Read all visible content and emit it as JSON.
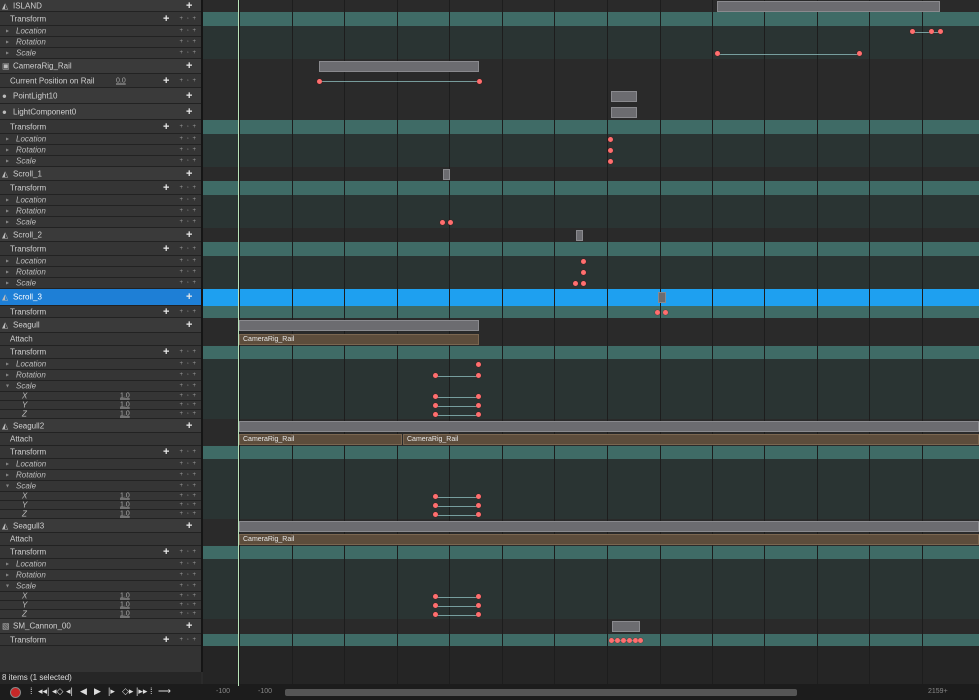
{
  "tree": [
    {
      "kind": "obj",
      "label": "ISLAND",
      "icon": "actor-icon",
      "plus": true
    },
    {
      "kind": "sub",
      "label": "Transform",
      "plus": true,
      "keydots": "+ ◦ +"
    },
    {
      "kind": "prop",
      "label": "Location",
      "keydots": "+ ◦ +"
    },
    {
      "kind": "prop",
      "label": "Rotation",
      "keydots": "+ ◦ +"
    },
    {
      "kind": "prop",
      "label": "Scale",
      "keydots": "+ ◦ +"
    },
    {
      "kind": "obj",
      "label": "CameraRig_Rail",
      "icon": "camera-rig-icon",
      "plus": true
    },
    {
      "kind": "sub",
      "label": "Current Position on Rail",
      "value": "0.0",
      "plus": true,
      "keydots": "+ ◦ +"
    },
    {
      "kind": "obj",
      "label": "PointLight10",
      "icon": "light-icon",
      "plus": true
    },
    {
      "kind": "obj",
      "label": "LightComponent0",
      "icon": "light-icon",
      "plus": true
    },
    {
      "kind": "sub",
      "label": "Transform",
      "plus": true,
      "keydots": "+ ◦ +"
    },
    {
      "kind": "prop",
      "label": "Location",
      "keydots": "+ ◦ +"
    },
    {
      "kind": "prop",
      "label": "Rotation",
      "keydots": "+ ◦ +"
    },
    {
      "kind": "prop",
      "label": "Scale",
      "keydots": "+ ◦ +"
    },
    {
      "kind": "obj",
      "label": "Scroll_1",
      "icon": "actor-icon",
      "plus": true
    },
    {
      "kind": "sub",
      "label": "Transform",
      "plus": true,
      "keydots": "+ ◦ +"
    },
    {
      "kind": "prop",
      "label": "Location",
      "keydots": "+ ◦ +"
    },
    {
      "kind": "prop",
      "label": "Rotation",
      "keydots": "+ ◦ +"
    },
    {
      "kind": "prop",
      "label": "Scale",
      "keydots": "+ ◦ +"
    },
    {
      "kind": "obj",
      "label": "Scroll_2",
      "icon": "actor-icon",
      "plus": true
    },
    {
      "kind": "sub",
      "label": "Transform",
      "plus": true,
      "keydots": "+ ◦ +"
    },
    {
      "kind": "prop",
      "label": "Location",
      "keydots": "+ ◦ +"
    },
    {
      "kind": "prop",
      "label": "Rotation",
      "keydots": "+ ◦ +"
    },
    {
      "kind": "prop",
      "label": "Scale",
      "keydots": "+ ◦ +"
    },
    {
      "kind": "sel",
      "label": "Scroll_3",
      "icon": "actor-icon",
      "plus": true
    },
    {
      "kind": "sub",
      "label": "Transform",
      "plus": true,
      "keydots": "+ ◦ +"
    },
    {
      "kind": "obj",
      "label": "Seagull",
      "icon": "actor-icon",
      "plus": true
    },
    {
      "kind": "sub",
      "label": "Attach"
    },
    {
      "kind": "sub",
      "label": "Transform",
      "plus": true,
      "keydots": "+ ◦ +"
    },
    {
      "kind": "prop",
      "label": "Location",
      "keydots": "+ ◦ +"
    },
    {
      "kind": "prop",
      "label": "Rotation",
      "keydots": "+ ◦ +"
    },
    {
      "kind": "prop",
      "label": "Scale",
      "open": true,
      "keydots": "+ ◦ +"
    },
    {
      "kind": "axis",
      "label": "X",
      "value": "1.0",
      "keydots": "+ ◦ +"
    },
    {
      "kind": "axis",
      "label": "Y",
      "value": "1.0",
      "keydots": "+ ◦ +"
    },
    {
      "kind": "axis",
      "label": "Z",
      "value": "1.0",
      "keydots": "+ ◦ +"
    },
    {
      "kind": "obj",
      "label": "Seagull2",
      "icon": "actor-icon",
      "plus": true
    },
    {
      "kind": "sub",
      "label": "Attach"
    },
    {
      "kind": "sub",
      "label": "Transform",
      "plus": true,
      "keydots": "+ ◦ +"
    },
    {
      "kind": "prop",
      "label": "Location",
      "keydots": "+ ◦ +"
    },
    {
      "kind": "prop",
      "label": "Rotation",
      "keydots": "+ ◦ +"
    },
    {
      "kind": "prop",
      "label": "Scale",
      "open": true,
      "keydots": "+ ◦ +"
    },
    {
      "kind": "axis",
      "label": "X",
      "value": "1.0",
      "keydots": "+ ◦ +"
    },
    {
      "kind": "axis",
      "label": "Y",
      "value": "1.0",
      "keydots": "+ ◦ +"
    },
    {
      "kind": "axis",
      "label": "Z",
      "value": "1.0",
      "keydots": "+ ◦ +"
    },
    {
      "kind": "obj",
      "label": "Seagull3",
      "icon": "actor-icon",
      "plus": true
    },
    {
      "kind": "sub",
      "label": "Attach"
    },
    {
      "kind": "sub",
      "label": "Transform",
      "plus": true,
      "keydots": "+ ◦ +"
    },
    {
      "kind": "prop",
      "label": "Location",
      "keydots": "+ ◦ +"
    },
    {
      "kind": "prop",
      "label": "Rotation",
      "keydots": "+ ◦ +"
    },
    {
      "kind": "prop",
      "label": "Scale",
      "open": true,
      "keydots": "+ ◦ +"
    },
    {
      "kind": "axis",
      "label": "X",
      "value": "1.0",
      "keydots": "+ ◦ +"
    },
    {
      "kind": "axis",
      "label": "Y",
      "value": "1.0",
      "keydots": "+ ◦ +"
    },
    {
      "kind": "axis",
      "label": "Z",
      "value": "1.0",
      "keydots": "+ ◦ +"
    },
    {
      "kind": "obj",
      "label": "SM_Cannon_00",
      "icon": "mesh-icon",
      "plus": true
    },
    {
      "kind": "sub",
      "label": "Transform",
      "plus": true,
      "keydots": "+ ◦ +"
    }
  ],
  "attach_labels": {
    "seagull": [
      "CameraRig_Rail"
    ],
    "seagull2": [
      "CameraRig_Rail",
      "CameraRig_Rail"
    ],
    "seagull3": [
      "CameraRig_Rail"
    ]
  },
  "status": {
    "items_text": "8 items (1 selected)"
  },
  "transport": {
    "range_start_a": "-100",
    "range_start_b": "-100",
    "range_end": "2159+",
    "buttons": [
      "step-icon",
      "jump-start-icon",
      "prev-key-icon",
      "step-back-icon",
      "play-reverse-icon",
      "play-icon",
      "step-forward-icon",
      "next-key-icon",
      "jump-end-icon",
      "step-icon",
      "loop-icon"
    ],
    "button_glyphs": [
      "⁞",
      "◂◂|",
      "◂◇",
      "◂|",
      "◀",
      "▶",
      "|▸",
      "◇▸",
      "|▸▸",
      "⁞",
      "⟶"
    ]
  },
  "colors": {
    "selection": "#1e7fd6",
    "key": "#ff6f6f",
    "group_lane": "#3f6b66",
    "attach_bar": "#5d4d3c"
  }
}
